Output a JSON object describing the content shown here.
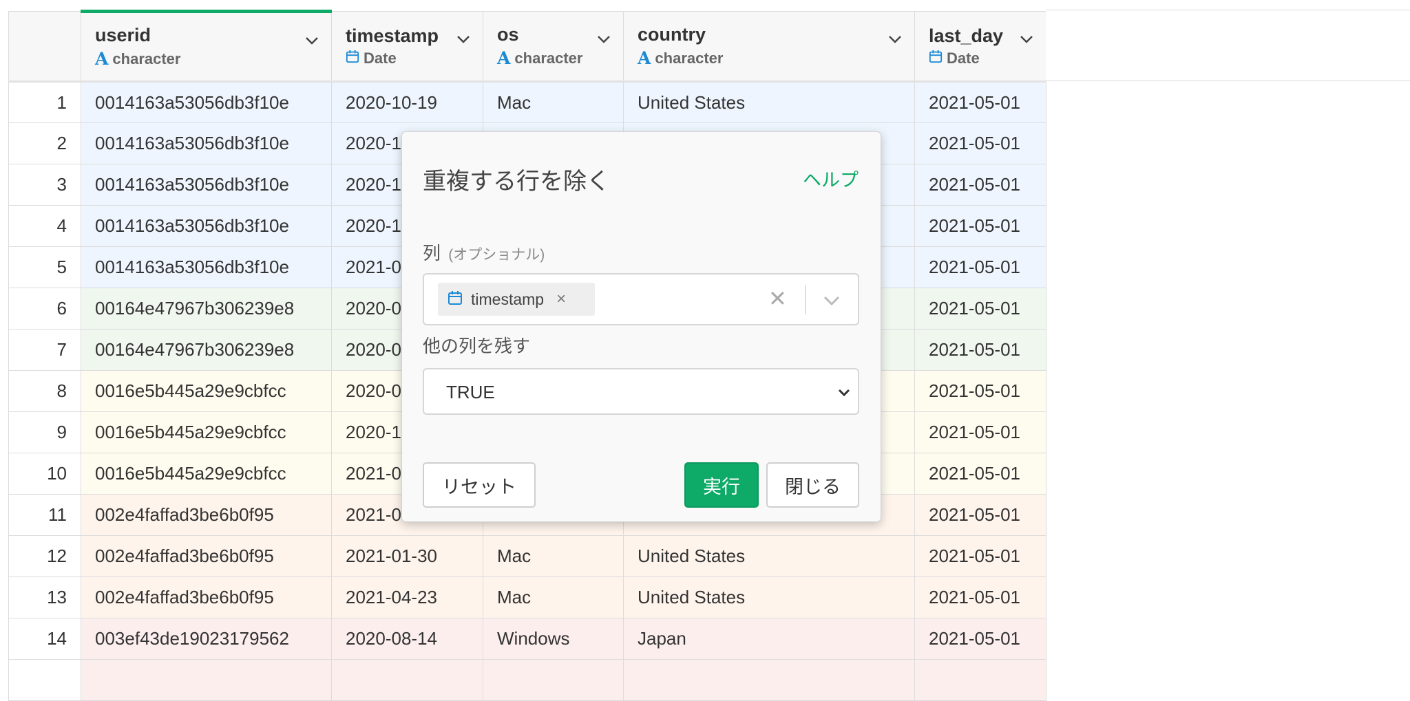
{
  "columns": [
    {
      "name": "userid",
      "type": "character",
      "type_icon": "character-type-icon"
    },
    {
      "name": "timestamp",
      "type": "Date",
      "type_icon": "calendar-icon"
    },
    {
      "name": "os",
      "type": "character",
      "type_icon": "character-type-icon"
    },
    {
      "name": "country",
      "type": "character",
      "type_icon": "character-type-icon"
    },
    {
      "name": "last_day",
      "type": "Date",
      "type_icon": "calendar-icon"
    }
  ],
  "type_glyph": "A",
  "rows": [
    {
      "n": "1",
      "userid": "0014163a53056db3f10e",
      "timestamp": "2020-10-19",
      "os": "Mac",
      "country": "United States",
      "last_day": "2021-05-01"
    },
    {
      "n": "2",
      "userid": "0014163a53056db3f10e",
      "timestamp": "2020-1",
      "os": "",
      "country": "",
      "last_day": "2021-05-01"
    },
    {
      "n": "3",
      "userid": "0014163a53056db3f10e",
      "timestamp": "2020-1",
      "os": "",
      "country": "",
      "last_day": "2021-05-01"
    },
    {
      "n": "4",
      "userid": "0014163a53056db3f10e",
      "timestamp": "2020-1",
      "os": "",
      "country": "",
      "last_day": "2021-05-01"
    },
    {
      "n": "5",
      "userid": "0014163a53056db3f10e",
      "timestamp": "2021-0",
      "os": "",
      "country": "",
      "last_day": "2021-05-01"
    },
    {
      "n": "6",
      "userid": "00164e47967b306239e8",
      "timestamp": "2020-0",
      "os": "",
      "country": "",
      "last_day": "2021-05-01"
    },
    {
      "n": "7",
      "userid": "00164e47967b306239e8",
      "timestamp": "2020-0",
      "os": "",
      "country": "",
      "last_day": "2021-05-01"
    },
    {
      "n": "8",
      "userid": "0016e5b445a29e9cbfcc",
      "timestamp": "2020-0",
      "os": "",
      "country": "",
      "last_day": "2021-05-01"
    },
    {
      "n": "9",
      "userid": "0016e5b445a29e9cbfcc",
      "timestamp": "2020-1",
      "os": "",
      "country": "",
      "last_day": "2021-05-01"
    },
    {
      "n": "10",
      "userid": "0016e5b445a29e9cbfcc",
      "timestamp": "2021-0",
      "os": "",
      "country": "",
      "last_day": "2021-05-01"
    },
    {
      "n": "11",
      "userid": "002e4faffad3be6b0f95",
      "timestamp": "2021-0",
      "os": "",
      "country": "",
      "last_day": "2021-05-01"
    },
    {
      "n": "12",
      "userid": "002e4faffad3be6b0f95",
      "timestamp": "2021-01-30",
      "os": "Mac",
      "country": "United States",
      "last_day": "2021-05-01"
    },
    {
      "n": "13",
      "userid": "002e4faffad3be6b0f95",
      "timestamp": "2021-04-23",
      "os": "Mac",
      "country": "United States",
      "last_day": "2021-05-01"
    },
    {
      "n": "14",
      "userid": "003ef43de19023179562",
      "timestamp": "2020-08-14",
      "os": "Windows",
      "country": "Japan",
      "last_day": "2021-05-01"
    },
    {
      "n": "",
      "userid": "",
      "timestamp": "",
      "os": "",
      "country": "",
      "last_day": ""
    }
  ],
  "group_colors": [
    "#eef5fe",
    "#eef5fe",
    "#eef5fe",
    "#eef5fe",
    "#eef5fe",
    "#f0f7ef",
    "#f0f7ef",
    "#fdfcee",
    "#fdfcee",
    "#fdfcee",
    "#fef4ec",
    "#fef4ec",
    "#fef4ec",
    "#fdeeee",
    "#fdeeee"
  ],
  "dialog": {
    "title": "重複する行を除く",
    "help": "ヘルプ",
    "columns_label": "列",
    "columns_optional": "(オプショナル)",
    "selected_chip": "timestamp",
    "chip_remove": "×",
    "clear": "✕",
    "keep_label": "他の列を残す",
    "keep_value": "TRUE",
    "reset": "リセット",
    "run": "実行",
    "close": "閉じる"
  },
  "colors": {
    "accent": "#0eaa68",
    "type_icon": "#1b8ad6"
  }
}
